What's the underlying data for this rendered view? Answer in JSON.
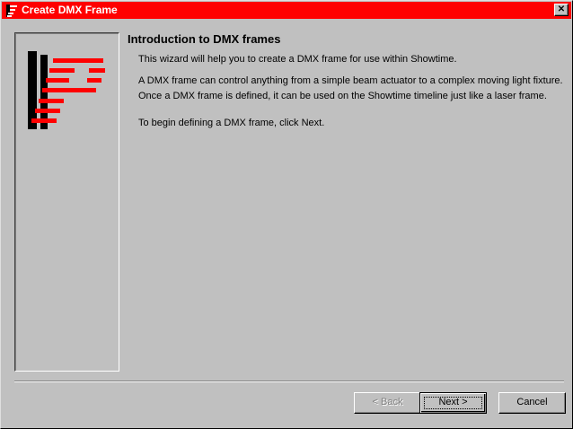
{
  "window": {
    "title": "Create DMX Frame",
    "close_glyph": "✕",
    "icon": "app-icon",
    "accent_color": "#ff0000"
  },
  "content": {
    "heading": "Introduction to DMX frames",
    "paragraph1": "This wizard will help you to create a DMX frame for use within Showtime.",
    "paragraph2_line1": "A DMX frame can control anything from a simple beam actuator to a complex moving light fixture.",
    "paragraph2_line2": "Once a DMX frame is defined, it can be used on the Showtime timeline just like a laser frame.",
    "paragraph3": "To begin defining a DMX frame, click Next."
  },
  "buttons": {
    "back": "< Back",
    "next": "Next >",
    "cancel": "Cancel"
  },
  "logo": {
    "icon": "dmx-logo-icon",
    "stripe_color": "#ff0000"
  }
}
